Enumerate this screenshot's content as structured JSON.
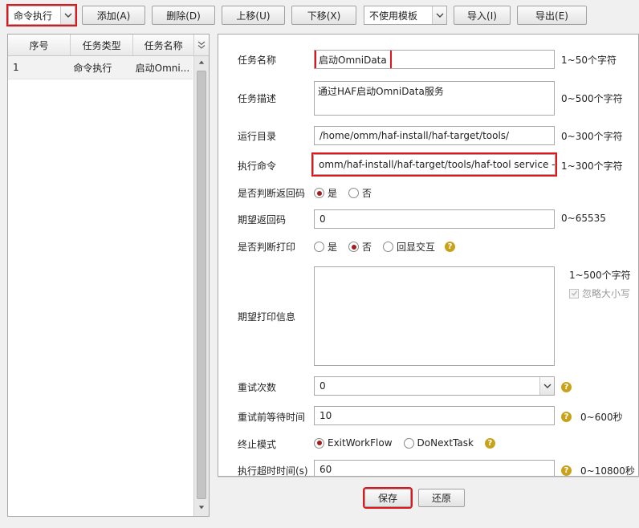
{
  "toolbar": {
    "task_type_select": "命令执行",
    "add": "添加(A)",
    "delete": "删除(D)",
    "move_up": "上移(U)",
    "move_down": "下移(X)",
    "template_select": "不使用模板",
    "import": "导入(I)",
    "export": "导出(E)"
  },
  "task_table": {
    "columns": [
      "序号",
      "任务类型",
      "任务名称"
    ],
    "rows": [
      {
        "no": "1",
        "type": "命令执行",
        "name": "启动Omni..."
      }
    ]
  },
  "form": {
    "task_name": {
      "label": "任务名称",
      "value": "启动OmniData",
      "hint": "1~50个字符"
    },
    "task_desc": {
      "label": "任务描述",
      "value": "通过HAF启动OmniData服务",
      "hint": "0~500个字符"
    },
    "run_dir": {
      "label": "运行目录",
      "value": "/home/omm/haf-install/haf-target/tools/",
      "hint": "0~300个字符"
    },
    "exec_cmd": {
      "label": "执行命令",
      "value": "omm/haf-install/haf-target/tools/haf-tool service --start",
      "hint": "1~300个字符"
    },
    "check_return": {
      "label": "是否判断返回码",
      "yes": "是",
      "no": "否",
      "selected": "是"
    },
    "expected_return": {
      "label": "期望返回码",
      "value": "0",
      "hint": "0~65535"
    },
    "check_print": {
      "label": "是否判断打印",
      "yes": "是",
      "no": "否",
      "interactive": "回显交互",
      "selected": "否"
    },
    "expected_print": {
      "label": "期望打印信息",
      "value": "",
      "hint": "1~500个字符",
      "ignore_case": "忽略大小写"
    },
    "retry_count": {
      "label": "重试次数",
      "value": "0"
    },
    "retry_wait": {
      "label": "重试前等待时间",
      "value": "10",
      "hint": "0~600秒"
    },
    "stop_mode": {
      "label": "终止模式",
      "opt1": "ExitWorkFlow",
      "opt2": "DoNextTask",
      "selected": "ExitWorkFlow"
    },
    "timeout": {
      "label": "执行超时时间(s)",
      "value": "60",
      "hint": "0~10800秒"
    }
  },
  "actions": {
    "save": "保存",
    "restore": "还原"
  },
  "colors": {
    "highlight": "#e0161a",
    "radio_selected": "#a61b1b",
    "help_icon": "#c8a21a"
  }
}
